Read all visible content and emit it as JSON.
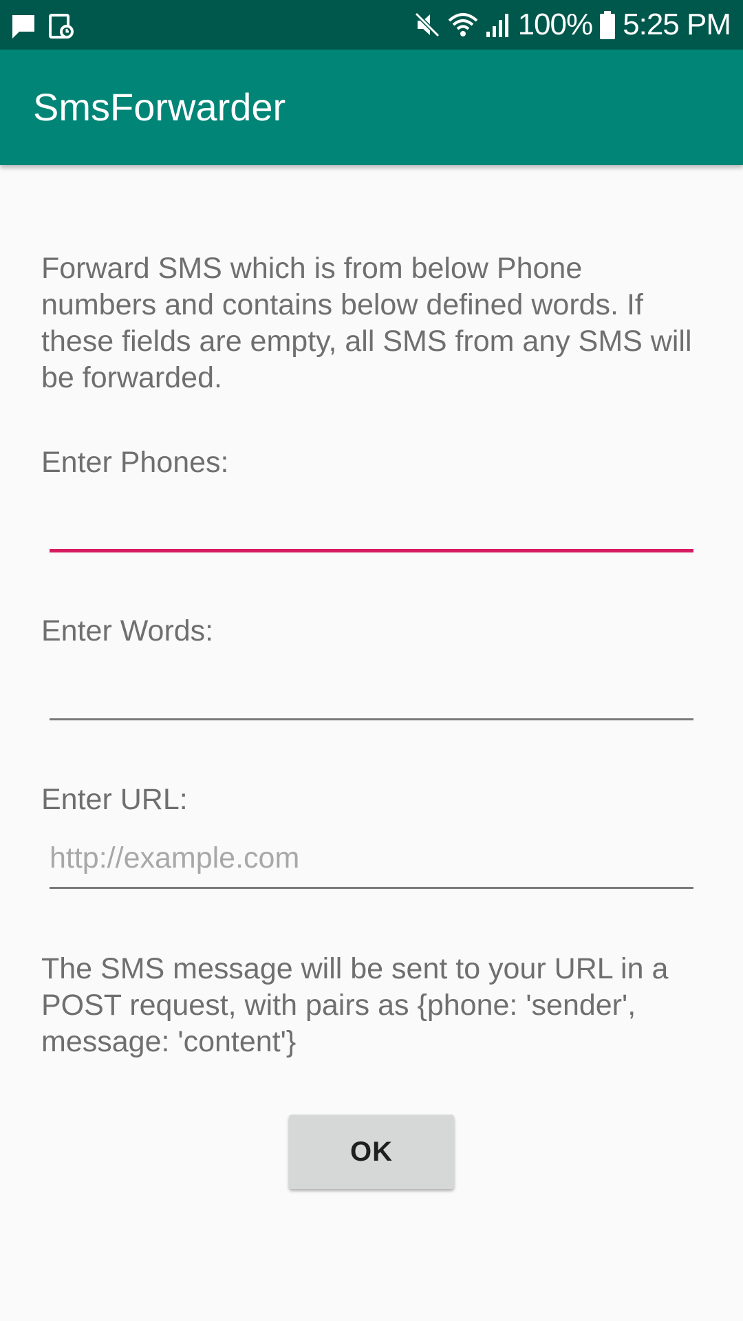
{
  "status_bar": {
    "battery_percent": "100%",
    "time": "5:25 PM",
    "icons": [
      "message-icon",
      "screenshot-icon",
      "mute-icon",
      "wifi-icon",
      "signal-icon",
      "battery-icon"
    ]
  },
  "app_bar": {
    "title": "SmsForwarder"
  },
  "form": {
    "description": "Forward SMS which is from below Phone numbers and contains below defined words. If these fields are empty, all SMS from any SMS will be forwarded.",
    "phones_label": "Enter Phones:",
    "phones_value": "",
    "words_label": "Enter Words:",
    "words_value": "",
    "url_label": "Enter URL:",
    "url_value": "",
    "url_placeholder": "http://example.com",
    "note": "The SMS message will be sent to your URL in a POST request, with pairs as {phone: 'sender', message: 'content'}",
    "ok_label": "OK"
  },
  "colors": {
    "status_bar": "#00574b",
    "app_bar": "#008577",
    "accent": "#d81b60",
    "background": "#fafafa"
  }
}
